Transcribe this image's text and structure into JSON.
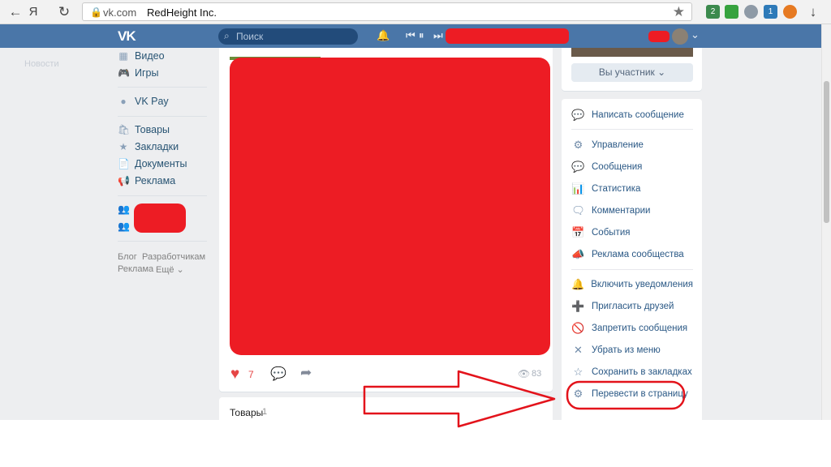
{
  "browser": {
    "back_icon": "←",
    "yandex_icon": "Я",
    "reload_icon": "↻",
    "lock_icon": "🔒",
    "domain": "vk.com",
    "page_title": "RedHeight Inc.",
    "star_icon": "★",
    "download_icon": "↓",
    "ext_badges": [
      "2",
      "1"
    ]
  },
  "vk_header": {
    "logo": "VK",
    "search_placeholder": "Поиск",
    "search_icon": "⌕",
    "bell_icon": "🔔",
    "prev_icon": "⏮",
    "pause_icon": "⏸",
    "next_icon": "⏭",
    "chevron_icon": "⌄"
  },
  "sidebar": {
    "ghost_item": "Новости",
    "items_top": [
      {
        "icon": "▦",
        "label": "Видео"
      },
      {
        "icon": "🎮",
        "label": "Игры"
      }
    ],
    "items_pay": [
      {
        "icon": "●",
        "label": "VK Pay"
      }
    ],
    "items_mid": [
      {
        "icon": "🛍",
        "label": "Товары"
      },
      {
        "icon": "★",
        "label": "Закладки"
      },
      {
        "icon": "📄",
        "label": "Документы"
      },
      {
        "icon": "📢",
        "label": "Реклама"
      }
    ],
    "group_icons": [
      "👥",
      "👥"
    ],
    "footer": {
      "blog": "Блог",
      "developers": "Разработчикам",
      "ads": "Реклама",
      "more": "Ещё ⌄"
    }
  },
  "post": {
    "like_icon": "♥",
    "likes": "7",
    "comment_icon": "💬",
    "share_icon": "➦",
    "views_icon": "👁",
    "views": "83"
  },
  "goods": {
    "title": "Товары",
    "count": "1"
  },
  "right_panel": {
    "member_button": "Вы участник ⌄",
    "menu": [
      {
        "icon": "💬",
        "label": "Написать сообщение"
      },
      {
        "icon": "⚙",
        "label": "Управление"
      },
      {
        "icon": "💬",
        "label": "Сообщения"
      },
      {
        "icon": "📊",
        "label": "Статистика"
      },
      {
        "icon": "🗨",
        "label": "Комментарии"
      },
      {
        "icon": "📅",
        "label": "События"
      },
      {
        "icon": "📣",
        "label": "Реклама сообщества"
      },
      {
        "icon": "🔔",
        "label": "Включить уведомления"
      },
      {
        "icon": "➕",
        "label": "Пригласить друзей"
      },
      {
        "icon": "🚫",
        "label": "Запретить сообщения"
      },
      {
        "icon": "✕",
        "label": "Убрать из меню"
      },
      {
        "icon": "☆",
        "label": "Сохранить в закладках"
      },
      {
        "icon": "⚙",
        "label": "Перевести в страницу"
      }
    ]
  },
  "annotation_color": "#e3131b"
}
